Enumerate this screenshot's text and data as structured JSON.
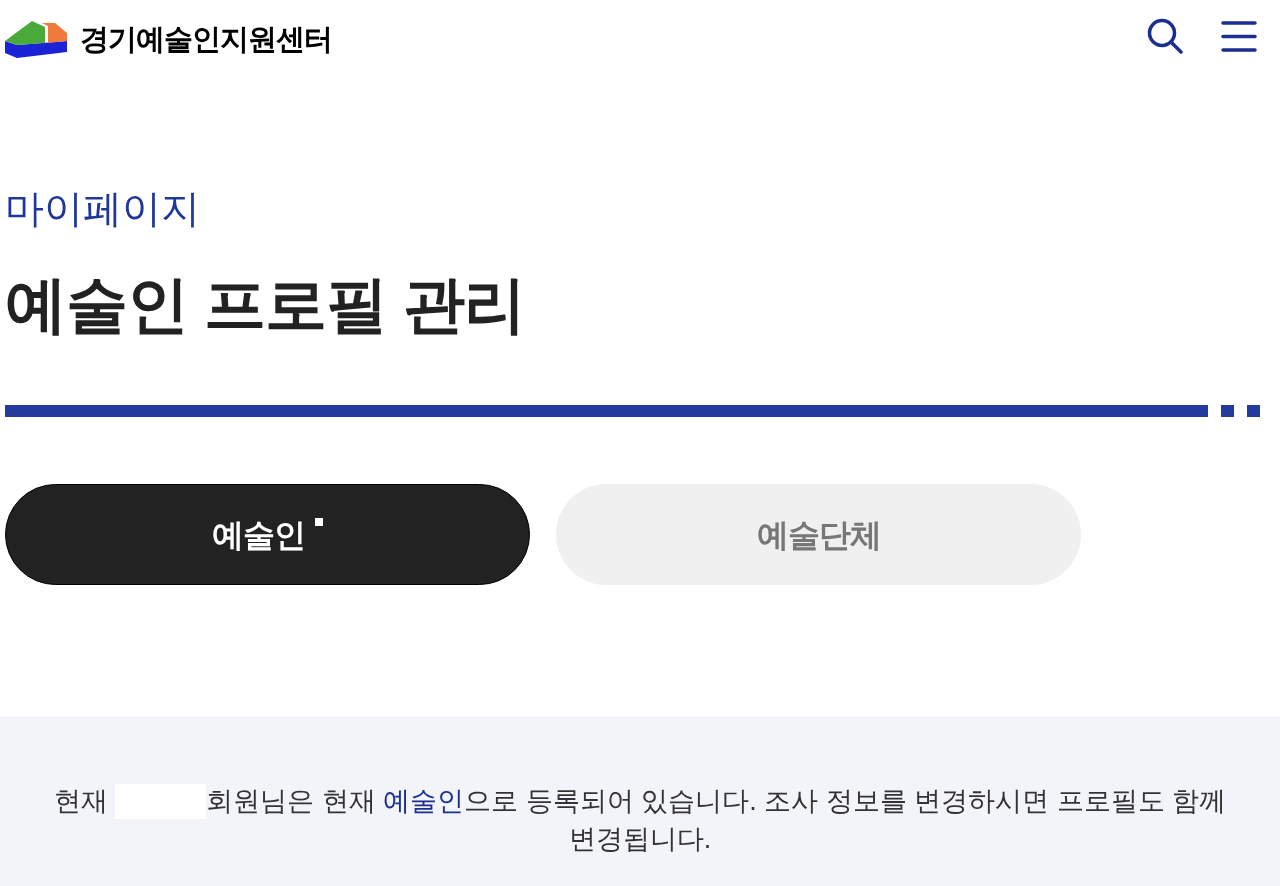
{
  "header": {
    "logo_text": "경기예술인지원센터"
  },
  "page": {
    "breadcrumb": "마이페이지",
    "title": "예술인 프로필 관리"
  },
  "tabs": [
    {
      "label": "예술인",
      "selected": true
    },
    {
      "label": "예술단체",
      "selected": false
    }
  ],
  "notice": {
    "lines": [
      [
        {
          "kind": "text",
          "text": "현재 "
        },
        {
          "kind": "redacted"
        },
        {
          "kind": "text",
          "text": "회원님은 현재 "
        },
        {
          "kind": "highlight",
          "text": "예술인"
        },
        {
          "kind": "text",
          "text": "으로 등록되어 있습니다. 조사 정보를 변경하시면 프로필도 함께"
        }
      ],
      [
        {
          "kind": "text",
          "text": "변경됩니다."
        }
      ]
    ]
  }
}
